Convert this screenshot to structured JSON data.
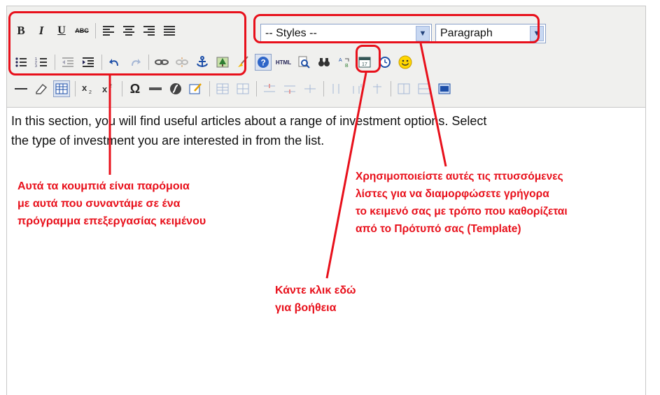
{
  "toolbar": {
    "row1": {
      "bold": "B",
      "italic": "I",
      "underline": "U",
      "strikethrough": "ABC",
      "styles_value": "-- Styles --",
      "format_value": "Paragraph"
    },
    "row2": {
      "html": "HTML"
    },
    "row3": {
      "omega": "Ω"
    }
  },
  "content": {
    "line1": "In this section, you will find useful articles about a range of investment options. Select",
    "line2": "the type of investment you are interested in from the list."
  },
  "annotations": {
    "formatting_note": [
      "Αυτά τα κουμπιά είναι παρόμοια",
      "με αυτά που συναντάμε σε ένα",
      "πρόγραμμα επεξεργασίας κειμένου"
    ],
    "styles_note": [
      "Χρησιμοποιείστε αυτές τις πτυσσόμενες",
      "λίστες για να διαμορφώσετε γρήγορα",
      "το κειμενό σας με τρόπο που καθορίζεται",
      "από το Πρότυπό σας (Template)"
    ],
    "help_note": [
      "Κάντε κλικ εδώ",
      "για βοήθεια"
    ]
  },
  "colors": {
    "annotation": "#e8101b",
    "toolbar_bg": "#f0f0ee"
  }
}
